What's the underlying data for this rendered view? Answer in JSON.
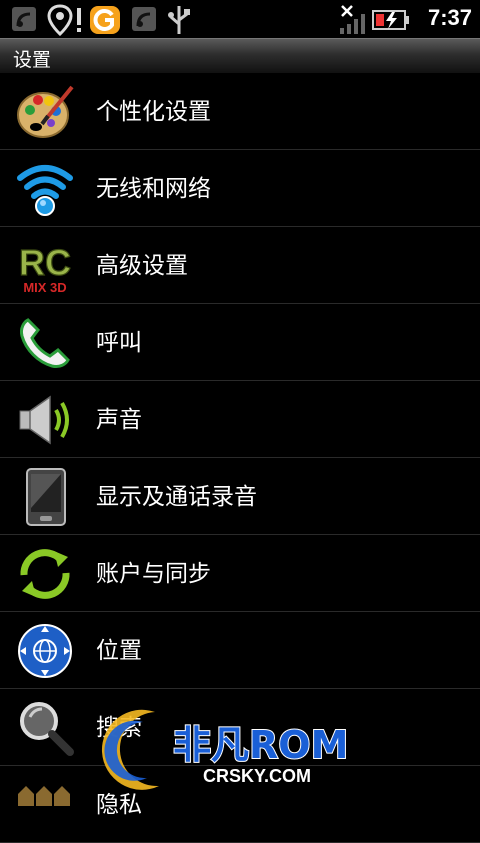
{
  "status_bar": {
    "time": "7:37",
    "icons": [
      "satellite-icon",
      "location-alert-icon",
      "app-notification-icon",
      "satellite-icon",
      "usb-icon",
      "signal-off-icon",
      "battery-charging-icon"
    ]
  },
  "header": {
    "title": "设置"
  },
  "settings_list": [
    {
      "label": "个性化设置",
      "icon": "palette-icon"
    },
    {
      "label": "无线和网络",
      "icon": "wifi-icon"
    },
    {
      "label": "高级设置",
      "icon": "rc-mix-logo-icon"
    },
    {
      "label": "呼叫",
      "icon": "phone-icon"
    },
    {
      "label": "声音",
      "icon": "speaker-icon"
    },
    {
      "label": "显示及通话录音",
      "icon": "device-display-icon"
    },
    {
      "label": "账户与同步",
      "icon": "sync-icon"
    },
    {
      "label": "位置",
      "icon": "globe-location-icon"
    },
    {
      "label": "搜索",
      "icon": "magnifier-icon"
    },
    {
      "label": "隐私",
      "icon": "privacy-icon"
    }
  ],
  "icon_text": {
    "rc": "RC",
    "mix": "MIX 3D"
  },
  "watermark": {
    "brand": "非凡ROM",
    "site": "CRSKY.COM"
  },
  "colors": {
    "background": "#000000",
    "wifi_blue": "#1e9be6",
    "sync_green": "#8ac926",
    "rc_green": "#9ab44a",
    "watermark_blue": "#1a5fd6"
  }
}
